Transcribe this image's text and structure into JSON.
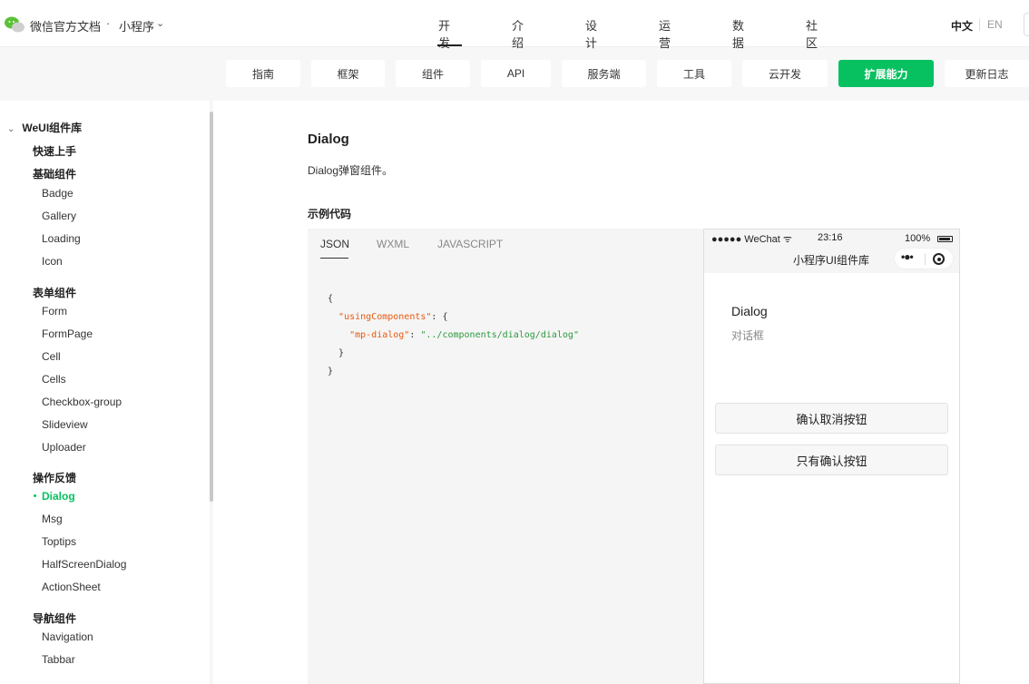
{
  "header": {
    "brand": "微信官方文档",
    "separator": "·",
    "product": "小程序",
    "nav": [
      "开发",
      "介绍",
      "设计",
      "运营",
      "数据",
      "社区"
    ],
    "lang_zh": "中文",
    "lang_en": "EN"
  },
  "subnav": [
    "指南",
    "框架",
    "组件",
    "API",
    "服务端",
    "工具",
    "云开发",
    "扩展能力",
    "更新日志"
  ],
  "sidebar": {
    "root": "WeUI组件库",
    "quickstart": "快速上手",
    "basic": "基础组件",
    "basic_items": [
      "Badge",
      "Gallery",
      "Loading",
      "Icon"
    ],
    "form": "表单组件",
    "form_items": [
      "Form",
      "FormPage",
      "Cell",
      "Cells",
      "Checkbox-group",
      "Slideview",
      "Uploader"
    ],
    "feedback": "操作反馈",
    "feedback_items": [
      "Dialog",
      "Msg",
      "Toptips",
      "HalfScreenDialog",
      "ActionSheet"
    ],
    "nav": "导航组件",
    "nav_items": [
      "Navigation",
      "Tabbar"
    ]
  },
  "content": {
    "title": "Dialog",
    "desc": "Dialog弹窗组件。",
    "example_heading": "示例代码",
    "tabs": [
      "JSON",
      "WXML",
      "JAVASCRIPT"
    ],
    "code": {
      "open": "{",
      "key1": "\"usingComponents\"",
      "colon_brace": ": {",
      "key2": "\"mp-dialog\"",
      "colon": ": ",
      "val2": "\"../components/dialog/dialog\"",
      "close_inner": "}",
      "close": "}"
    }
  },
  "phone": {
    "carrier": "●●●●● WeChat ᯤ",
    "time": "23:16",
    "battery": "100%",
    "nav_title": "小程序UI组件库",
    "title": "Dialog",
    "subtitle": "对话框",
    "btn1": "确认取消按钮",
    "btn2": "只有确认按钮"
  },
  "colors": {
    "accent": "#07c160"
  }
}
